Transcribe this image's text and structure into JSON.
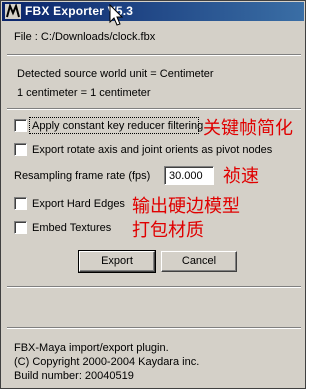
{
  "window": {
    "title": "FBX Exporter V5.3"
  },
  "info": {
    "file_line": "File : C:/Downloads/clock.fbx",
    "unit_line": "Detected source world unit = Centimeter",
    "conversion_line": "1 centimeter = 1 centimeter"
  },
  "options": {
    "constant_key_reducer": {
      "label": "Apply constant key reducer filtering",
      "checked": false,
      "annotation": "关键帧简化"
    },
    "rotate_axis": {
      "label": "Export rotate axis and joint orients as pivot nodes",
      "checked": false
    },
    "resampling": {
      "label": "Resampling frame rate (fps)",
      "value": "30.000",
      "annotation": "祯速"
    },
    "hard_edges": {
      "label": "Export Hard Edges",
      "checked": false,
      "annotation": "输出硬边模型"
    },
    "embed_textures": {
      "label": "Embed Textures",
      "checked": false,
      "annotation": "打包材质"
    }
  },
  "buttons": {
    "export": "Export",
    "cancel": "Cancel"
  },
  "footer": {
    "plugin": "FBX-Maya import/export plugin.",
    "copyright": "(C) Copyright 2000-2004 Kaydara inc.",
    "build": "Build number: 20040519"
  },
  "colors": {
    "title_bar": "#0a246a",
    "window_bg": "#d4d0c8",
    "annotation": "#e00000"
  },
  "icons": {
    "app": "fbx-app-icon",
    "pointer": "mouse-pointer-icon"
  }
}
